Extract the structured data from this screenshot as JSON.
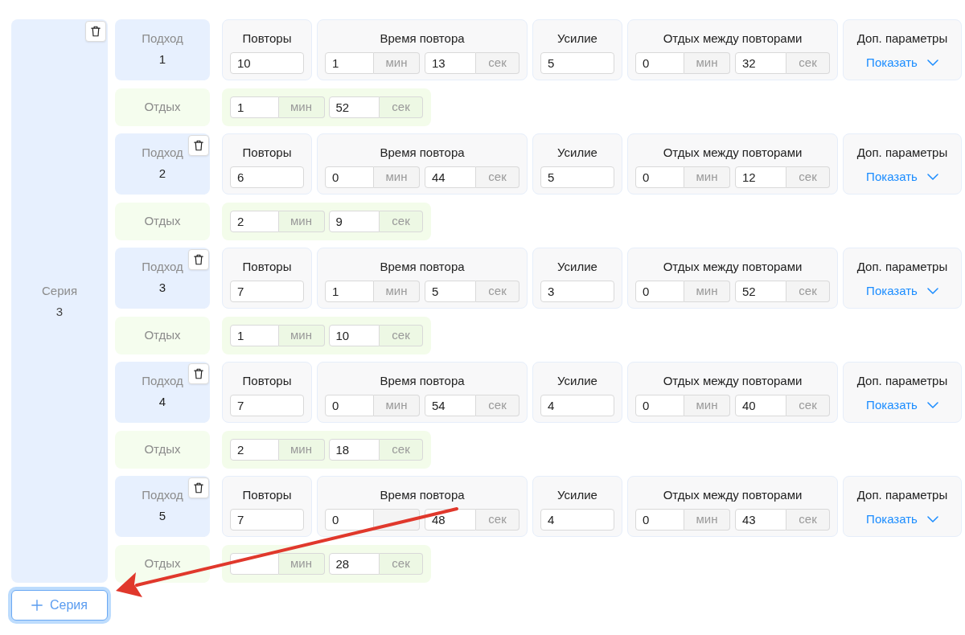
{
  "series": {
    "label": "Серия",
    "number": "3",
    "deletable": true,
    "sets": [
      {
        "approach": {
          "label": "Подход",
          "number": "1",
          "deletable": false
        },
        "params": [
          {
            "kind": "number",
            "label": "Повторы",
            "value": "10"
          },
          {
            "kind": "duration",
            "label": "Время повтора",
            "minutes": "1",
            "min_unit": "мин",
            "seconds": "13",
            "sec_unit": "сек"
          },
          {
            "kind": "number",
            "label": "Усилие",
            "value": "5"
          },
          {
            "kind": "duration",
            "label": "Отдых между повторами",
            "minutes": "0",
            "min_unit": "мин",
            "seconds": "32",
            "sec_unit": "сек"
          },
          {
            "kind": "more",
            "label": "Доп. параметры",
            "link": "Показать",
            "expanded": false
          }
        ],
        "rest": {
          "label": "Отдых",
          "minutes": "1",
          "min_unit": "мин",
          "seconds": "52",
          "sec_unit": "сек"
        }
      },
      {
        "approach": {
          "label": "Подход",
          "number": "2",
          "deletable": true
        },
        "params": [
          {
            "kind": "number",
            "label": "Повторы",
            "value": "6"
          },
          {
            "kind": "duration",
            "label": "Время повтора",
            "minutes": "0",
            "min_unit": "мин",
            "seconds": "44",
            "sec_unit": "сек"
          },
          {
            "kind": "number",
            "label": "Усилие",
            "value": "5"
          },
          {
            "kind": "duration",
            "label": "Отдых между повторами",
            "minutes": "0",
            "min_unit": "мин",
            "seconds": "12",
            "sec_unit": "сек"
          },
          {
            "kind": "more",
            "label": "Доп. параметры",
            "link": "Показать",
            "expanded": false
          }
        ],
        "rest": {
          "label": "Отдых",
          "minutes": "2",
          "min_unit": "мин",
          "seconds": "9",
          "sec_unit": "сек"
        }
      },
      {
        "approach": {
          "label": "Подход",
          "number": "3",
          "deletable": true
        },
        "params": [
          {
            "kind": "number",
            "label": "Повторы",
            "value": "7"
          },
          {
            "kind": "duration",
            "label": "Время повтора",
            "minutes": "1",
            "min_unit": "мин",
            "seconds": "5",
            "sec_unit": "сек"
          },
          {
            "kind": "number",
            "label": "Усилие",
            "value": "3"
          },
          {
            "kind": "duration",
            "label": "Отдых между повторами",
            "minutes": "0",
            "min_unit": "мин",
            "seconds": "52",
            "sec_unit": "сек"
          },
          {
            "kind": "more",
            "label": "Доп. параметры",
            "link": "Показать",
            "expanded": false
          }
        ],
        "rest": {
          "label": "Отдых",
          "minutes": "1",
          "min_unit": "мин",
          "seconds": "10",
          "sec_unit": "сек"
        }
      },
      {
        "approach": {
          "label": "Подход",
          "number": "4",
          "deletable": true
        },
        "params": [
          {
            "kind": "number",
            "label": "Повторы",
            "value": "7"
          },
          {
            "kind": "duration",
            "label": "Время повтора",
            "minutes": "0",
            "min_unit": "мин",
            "seconds": "54",
            "sec_unit": "сек"
          },
          {
            "kind": "number",
            "label": "Усилие",
            "value": "4"
          },
          {
            "kind": "duration",
            "label": "Отдых между повторами",
            "minutes": "0",
            "min_unit": "мин",
            "seconds": "40",
            "sec_unit": "сек"
          },
          {
            "kind": "more",
            "label": "Доп. параметры",
            "link": "Показать",
            "expanded": false
          }
        ],
        "rest": {
          "label": "Отдых",
          "minutes": "2",
          "min_unit": "мин",
          "seconds": "18",
          "sec_unit": "сек"
        }
      },
      {
        "approach": {
          "label": "Подход",
          "number": "5",
          "deletable": true
        },
        "params": [
          {
            "kind": "number",
            "label": "Повторы",
            "value": "7"
          },
          {
            "kind": "duration",
            "label": "Время повтора",
            "minutes": "0",
            "seconds": "48",
            "sec_unit": "сек"
          },
          {
            "kind": "number",
            "label": "Усилие",
            "value": "4"
          },
          {
            "kind": "duration",
            "label": "Отдых между повторами",
            "minutes": "0",
            "min_unit": "мин",
            "seconds": "43",
            "sec_unit": "сек"
          },
          {
            "kind": "more",
            "label": "Доп. параметры",
            "link": "Показать",
            "expanded": false
          }
        ],
        "rest": {
          "label": "Отдых",
          "min_unit": "мин",
          "seconds": "28",
          "sec_unit": "сек"
        }
      }
    ]
  },
  "add_series_button": {
    "label": "Серия"
  }
}
